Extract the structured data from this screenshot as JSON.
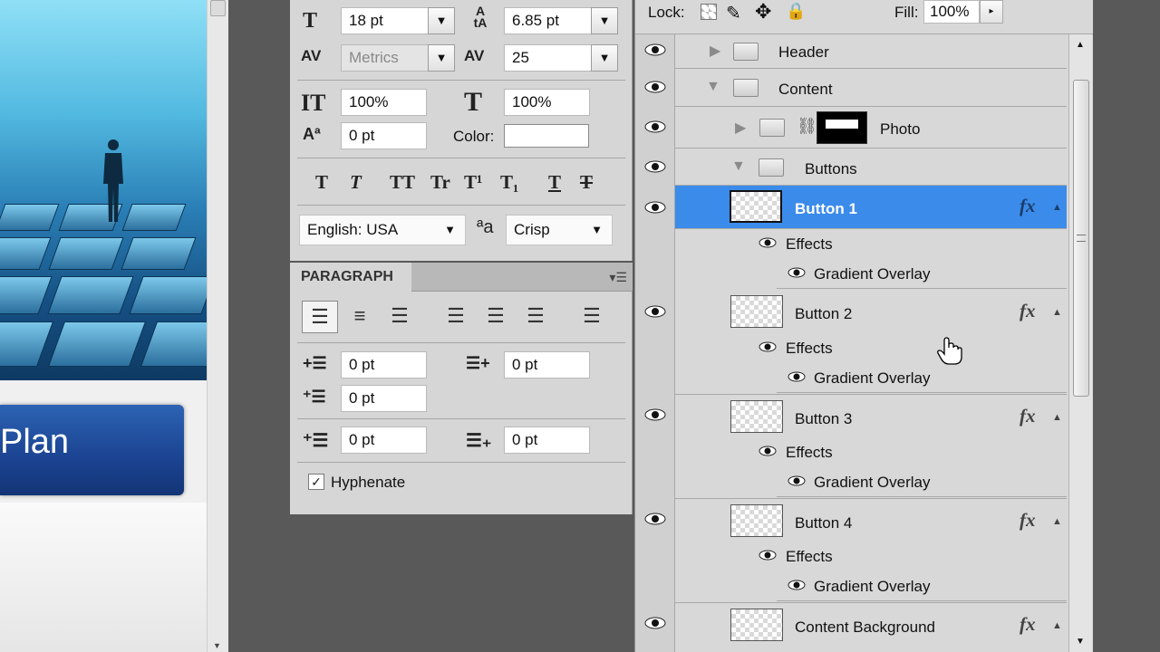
{
  "character": {
    "font_size": "18 pt",
    "leading": "6.85 pt",
    "kerning": "Metrics",
    "tracking": "25",
    "vertical_scale": "100%",
    "horizontal_scale": "100%",
    "baseline_shift": "0 pt",
    "color_label": "Color:",
    "language": "English: USA",
    "antialias_icon": "aa",
    "antialias": "Crisp",
    "style_buttons": [
      "T",
      "T",
      "TT",
      "Tr",
      "T¹",
      "T₁",
      "T",
      "T"
    ]
  },
  "paragraph": {
    "title": "PARAGRAPH",
    "indent_left": "0 pt",
    "indent_right": "0 pt",
    "indent_first": "0 pt",
    "space_before": "0 pt",
    "space_after": "0 pt",
    "hyphenate_label": "Hyphenate",
    "hyphenate_checked": true
  },
  "canvas": {
    "banner_text": "Plan"
  },
  "layers": {
    "lock_label": "Lock:",
    "fill_label": "Fill:",
    "fill_value": "100%",
    "items": [
      {
        "name": "Header",
        "kind": "group-collapsed"
      },
      {
        "name": "Content",
        "kind": "group-expanded"
      },
      {
        "name": "Photo",
        "kind": "group-masked"
      },
      {
        "name": "Buttons",
        "kind": "group-expanded"
      },
      {
        "name": "Button 1",
        "kind": "layer",
        "selected": true
      },
      {
        "name": "Effects",
        "kind": "effects"
      },
      {
        "name": "Gradient Overlay",
        "kind": "effect"
      },
      {
        "name": "Button 2",
        "kind": "layer"
      },
      {
        "name": "Effects",
        "kind": "effects"
      },
      {
        "name": "Gradient Overlay",
        "kind": "effect"
      },
      {
        "name": "Button 3",
        "kind": "layer"
      },
      {
        "name": "Effects",
        "kind": "effects"
      },
      {
        "name": "Gradient Overlay",
        "kind": "effect"
      },
      {
        "name": "Button 4",
        "kind": "layer"
      },
      {
        "name": "Effects",
        "kind": "effects"
      },
      {
        "name": "Gradient Overlay",
        "kind": "effect"
      },
      {
        "name": "Content Background",
        "kind": "layer"
      }
    ],
    "fx_label": "fx"
  },
  "colors": {
    "selection": "#3b8bea",
    "panel": "#d6d6d6",
    "workspace": "#595959"
  }
}
